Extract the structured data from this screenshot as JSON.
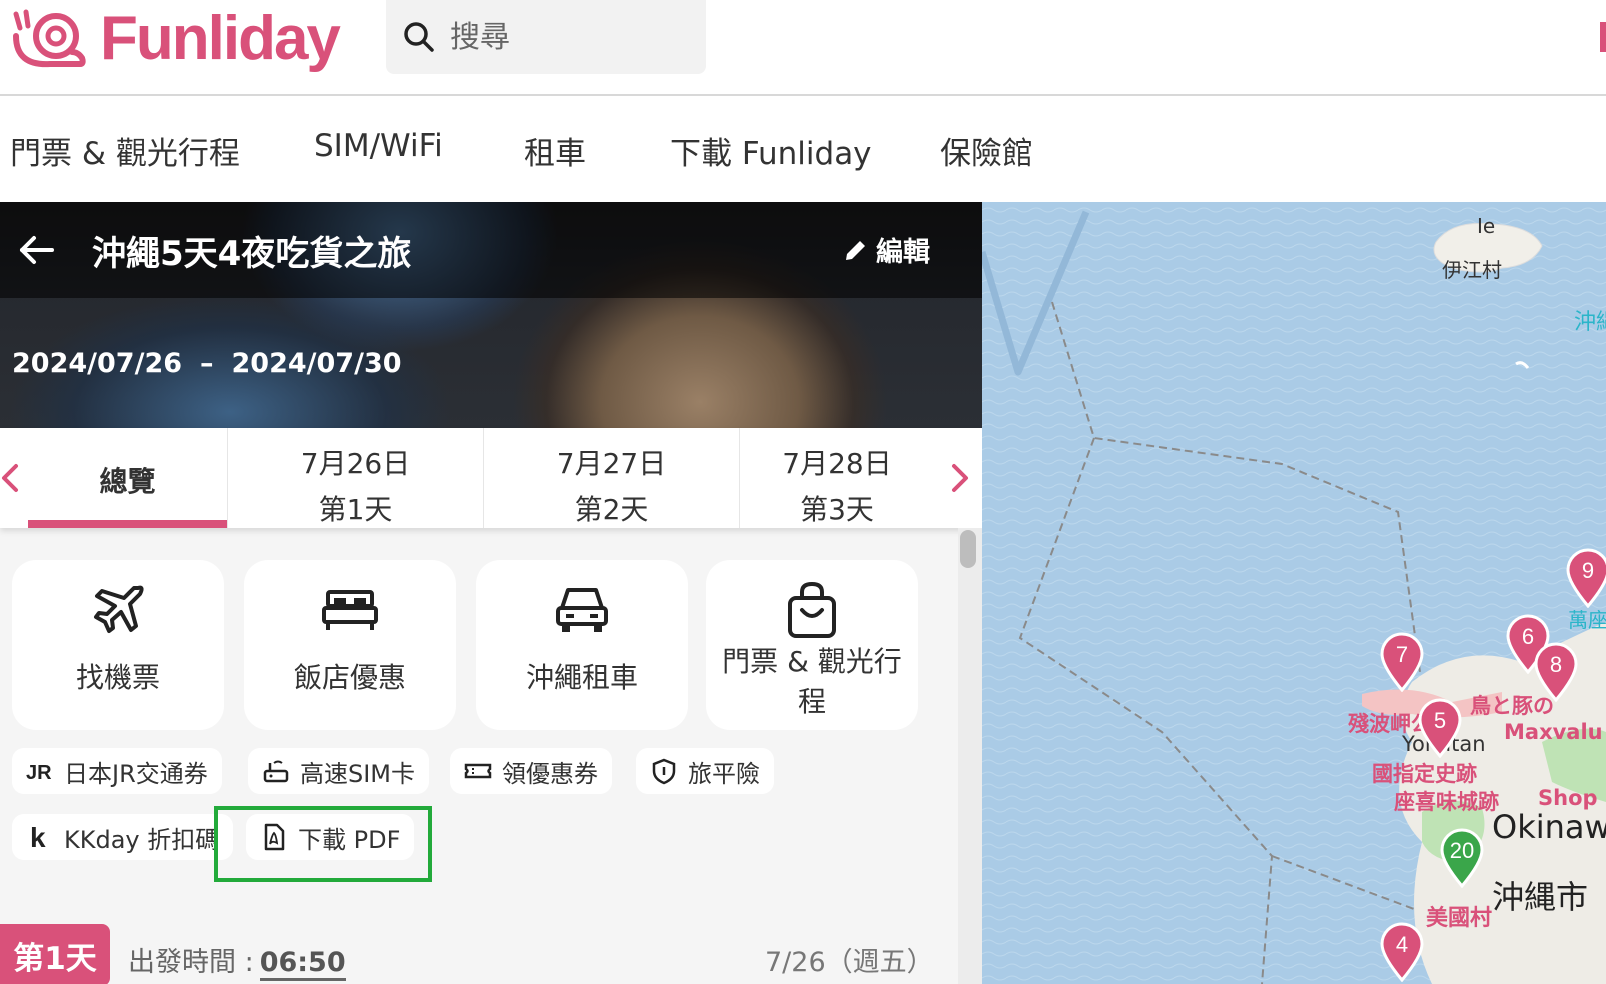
{
  "brand": {
    "name": "Funliday",
    "color": "#d9517a"
  },
  "search": {
    "placeholder": "搜尋",
    "icon": "search-icon"
  },
  "nav": {
    "items": [
      {
        "label": "門票 & 觀光行程"
      },
      {
        "label": "SIM/WiFi"
      },
      {
        "label": "租車"
      },
      {
        "label": "下載 Funliday"
      },
      {
        "label": "保險館"
      }
    ]
  },
  "trip": {
    "title": "沖繩5天4夜吃貨之旅",
    "edit_label": "編輯",
    "start_date": "2024/07/26",
    "date_separator": "–",
    "end_date": "2024/07/30"
  },
  "tabs": {
    "overview_label": "總覽",
    "days": [
      {
        "date": "7月26日",
        "day": "第1天"
      },
      {
        "date": "7月27日",
        "day": "第2天"
      },
      {
        "date": "7月28日",
        "day": "第3天"
      }
    ]
  },
  "cards": [
    {
      "label": "找機票",
      "icon": "airplane-icon"
    },
    {
      "label": "飯店優惠",
      "icon": "bed-icon"
    },
    {
      "label": "沖繩租車",
      "icon": "car-icon"
    },
    {
      "label": "門票 & 觀光行程",
      "icon": "shopping-bag-icon"
    }
  ],
  "pills": [
    {
      "label": "日本JR交通券",
      "icon": "jr-logo-icon"
    },
    {
      "label": "高速SIM卡",
      "icon": "sim-router-icon"
    },
    {
      "label": "領優惠券",
      "icon": "ticket-icon"
    },
    {
      "label": "旅平險",
      "icon": "shield-icon"
    },
    {
      "label": "KKday 折扣碼",
      "icon": "kkday-logo-icon"
    },
    {
      "label": "下載 PDF",
      "icon": "pdf-file-icon"
    }
  ],
  "day_section": {
    "badge": "第1天",
    "depart_label": "出發時間 :",
    "depart_time": "06:50",
    "date": "7/26（週五）"
  },
  "map": {
    "labels": {
      "ie": "Ie",
      "ie_village": "伊江村",
      "okinawa_top": "沖縄",
      "manza": "萬座",
      "zanpa": "殘波岬公",
      "yomitan": "Yomitan",
      "national_site": "國指定史跡",
      "zakimi": "座喜味城跡",
      "torito": "鳥と豚の",
      "maxvalu": "Maxvalu",
      "okinawa_en": "Okinawa",
      "okinawa_city": "沖縄市",
      "mihama": "美國村",
      "shop": "Shop"
    },
    "markers": [
      {
        "label": "7",
        "color": "#d9517a"
      },
      {
        "label": "5",
        "color": "#d9517a"
      },
      {
        "label": "6",
        "color": "#d9517a"
      },
      {
        "label": "8",
        "color": "#d9517a"
      },
      {
        "label": "9",
        "color": "#d9517a"
      },
      {
        "label": "20",
        "color": "#3aa64a"
      },
      {
        "label": "4",
        "color": "#d9517a"
      }
    ]
  }
}
